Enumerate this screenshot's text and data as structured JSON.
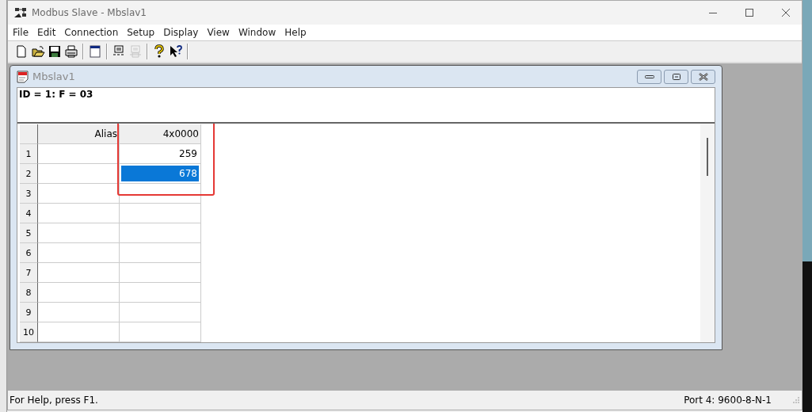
{
  "window": {
    "title": "Modbus Slave - Mbslav1"
  },
  "menu": [
    "File",
    "Edit",
    "Connection",
    "Setup",
    "Display",
    "View",
    "Window",
    "Help"
  ],
  "toolbar": [
    {
      "kind": "new",
      "disabled": false
    },
    {
      "kind": "open",
      "disabled": false
    },
    {
      "kind": "save",
      "disabled": false
    },
    {
      "kind": "print",
      "disabled": false
    },
    {
      "kind": "separator"
    },
    {
      "kind": "window",
      "disabled": false
    },
    {
      "kind": "separator"
    },
    {
      "kind": "connect",
      "disabled": false
    },
    {
      "kind": "disconnect",
      "disabled": true
    },
    {
      "kind": "separator"
    },
    {
      "kind": "help",
      "disabled": false
    },
    {
      "kind": "context-help",
      "disabled": false
    }
  ],
  "child_window": {
    "title": "Mbslav1",
    "header": "ID = 1: F = 03",
    "columns": [
      "Alias",
      "4x0000"
    ],
    "rows": [
      {
        "number": "1",
        "value": "259",
        "selected": false
      },
      {
        "number": "2",
        "value": "678",
        "selected": true
      },
      {
        "number": "3",
        "selected": false
      },
      {
        "number": "4",
        "selected": false
      },
      {
        "number": "5",
        "selected": false
      },
      {
        "number": "6",
        "selected": false
      },
      {
        "number": "7",
        "selected": false
      },
      {
        "number": "8",
        "selected": false
      },
      {
        "number": "9",
        "selected": false
      },
      {
        "number": "10",
        "selected": false
      }
    ],
    "highlight": {
      "kind": "rectangle"
    }
  },
  "status_bar": {
    "help": "For Help, press F1.",
    "port": "Port 4: 9600-8-N-1"
  }
}
